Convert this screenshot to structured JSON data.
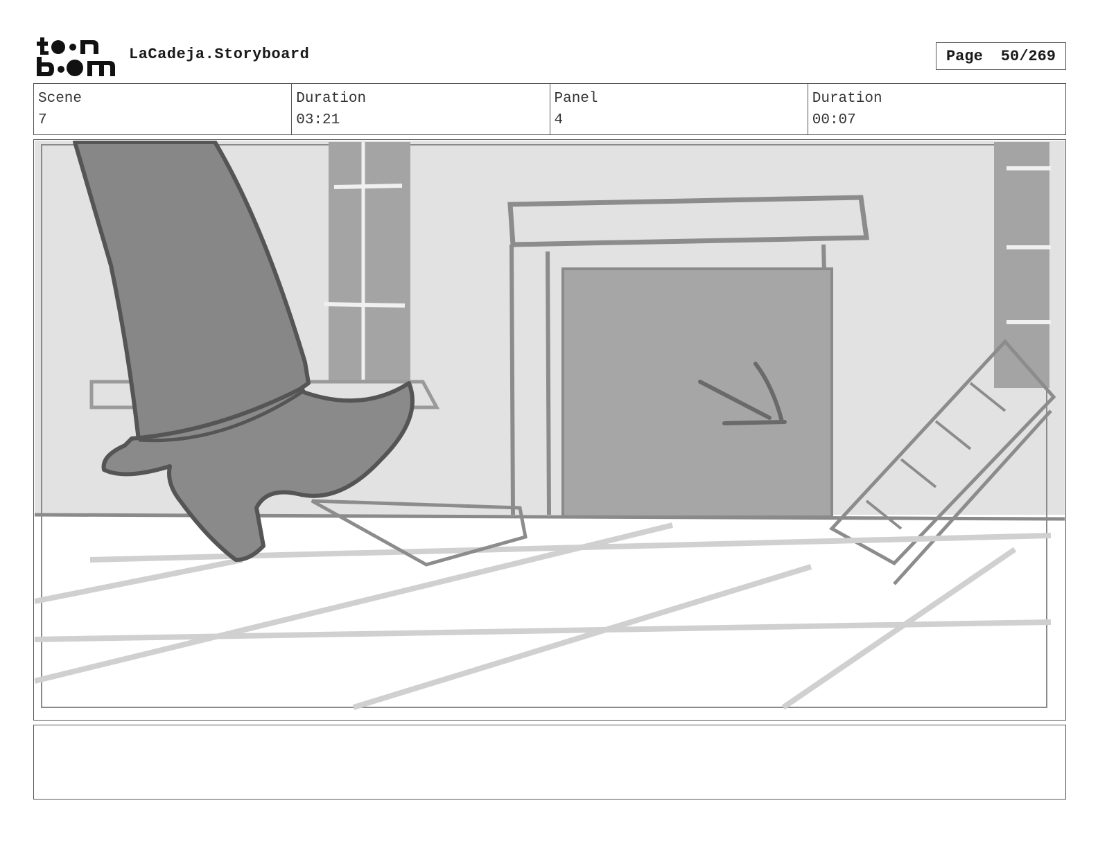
{
  "header": {
    "logo_text": "toon boom",
    "document_title": "LaCadeja.Storyboard",
    "page_label": "Page",
    "page_value": "50/269"
  },
  "info": {
    "scene_label": "Scene",
    "scene_value": "7",
    "scene_duration_label": "Duration",
    "scene_duration_value": "03:21",
    "panel_label": "Panel",
    "panel_value": "4",
    "panel_duration_label": "Duration",
    "panel_duration_value": "00:07"
  },
  "notes": {
    "text": ""
  },
  "colors": {
    "border": "#555555",
    "wall": "#e2e2e2",
    "floor": "#ffffff",
    "dark_fill": "#8a8a8a",
    "door_fill": "#a6a6a6",
    "line": "#6a6a6a",
    "light_line": "#cfcfcf"
  }
}
